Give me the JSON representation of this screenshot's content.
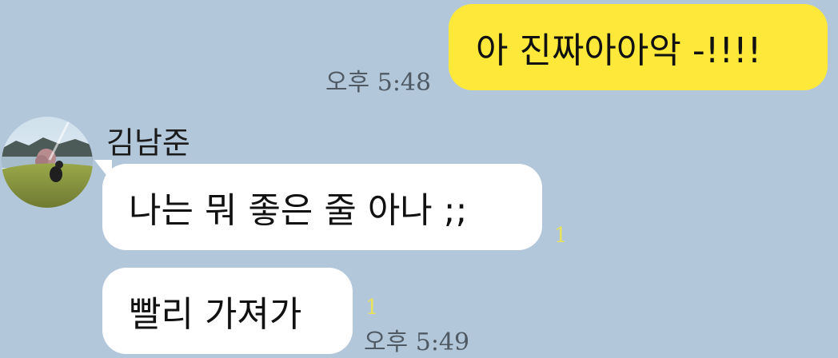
{
  "messages": {
    "sent": {
      "text": "아 진짜아아악 -!!!!",
      "time": "오후 5:48"
    },
    "sender_name": "김남준",
    "received": [
      {
        "text": "나는 뭐 좋은 줄 아나 ;;",
        "unread": "1"
      },
      {
        "text": "빨리 가져가",
        "unread": "1",
        "time": "오후 5:49"
      }
    ]
  },
  "icons": {
    "avatar": "profile-photo-landscape"
  },
  "colors": {
    "background": "#b2c7da",
    "sent_bubble": "#fee93a",
    "received_bubble": "#ffffff",
    "unread_count": "#e8e25a"
  }
}
